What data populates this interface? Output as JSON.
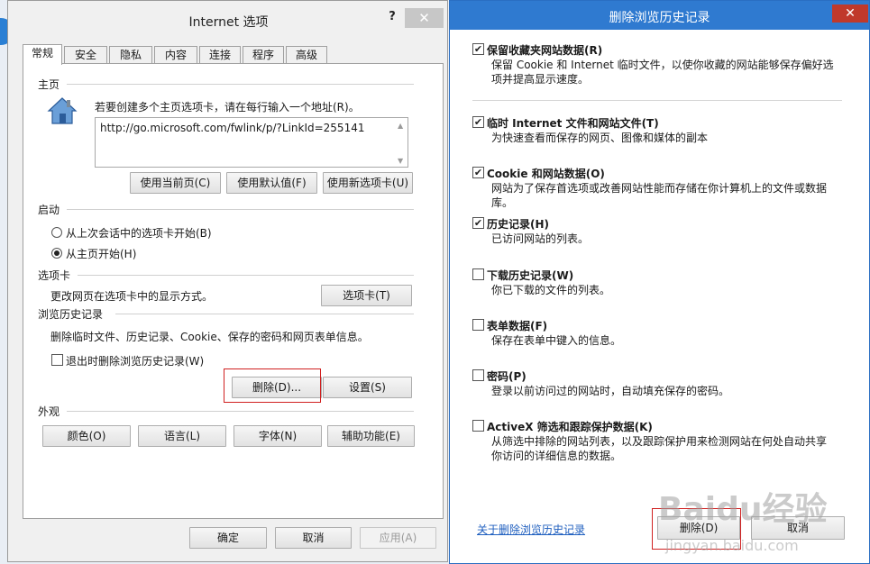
{
  "left_dialog": {
    "title": "Internet 选项",
    "help": "?",
    "close": "✕",
    "tabs": [
      "常规",
      "安全",
      "隐私",
      "内容",
      "连接",
      "程序",
      "高级"
    ],
    "home": {
      "section": "主页",
      "hint": "若要创建多个主页选项卡，请在每行输入一个地址(R)。",
      "url": "http://go.microsoft.com/fwlink/p/?LinkId=255141",
      "buttons": [
        "使用当前页(C)",
        "使用默认值(F)",
        "使用新选项卡(U)"
      ]
    },
    "startup": {
      "section": "启动",
      "option1": "从上次会话中的选项卡开始(B)",
      "option2": "从主页开始(H)"
    },
    "tabs_section": {
      "section": "选项卡",
      "desc": "更改网页在选项卡中的显示方式。",
      "button": "选项卡(T)"
    },
    "history": {
      "section": "浏览历史记录",
      "desc": "删除临时文件、历史记录、Cookie、保存的密码和网页表单信息。",
      "checkbox": "退出时删除浏览历史记录(W)",
      "delete_button": "删除(D)...",
      "settings_button": "设置(S)"
    },
    "appearance": {
      "section": "外观",
      "buttons": [
        "颜色(O)",
        "语言(L)",
        "字体(N)",
        "辅助功能(E)"
      ]
    },
    "footer": {
      "ok": "确定",
      "cancel": "取消",
      "apply": "应用(A)"
    }
  },
  "right_dialog": {
    "title": "删除浏览历史记录",
    "close": "✕",
    "options": [
      {
        "title": "保留收藏夹网站数据(R)",
        "desc": "保留 Cookie 和 Internet 临时文件，以使你收藏的网站能够保存偏好选项并提高显示速度。",
        "checked": true
      },
      {
        "title": "临时 Internet 文件和网站文件(T)",
        "desc": "为快速查看而保存的网页、图像和媒体的副本",
        "checked": true
      },
      {
        "title": "Cookie 和网站数据(O)",
        "desc": "网站为了保存首选项或改善网站性能而存储在你计算机上的文件或数据库。",
        "checked": true
      },
      {
        "title": "历史记录(H)",
        "desc": "已访问网站的列表。",
        "checked": true
      },
      {
        "title": "下载历史记录(W)",
        "desc": "你已下载的文件的列表。",
        "checked": false
      },
      {
        "title": "表单数据(F)",
        "desc": "保存在表单中键入的信息。",
        "checked": false
      },
      {
        "title": "密码(P)",
        "desc": "登录以前访问过的网站时，自动填充保存的密码。",
        "checked": false
      },
      {
        "title": "ActiveX 筛选和跟踪保护数据(K)",
        "desc": "从筛选中排除的网站列表，以及跟踪保护用来检测网站在何处自动共享你访问的详细信息的数据。",
        "checked": false
      }
    ],
    "link": "关于删除浏览历史记录",
    "delete_button": "删除(D)",
    "cancel_button": "取消"
  },
  "watermark": {
    "brand": "Baidu经验",
    "url": "jingyan.baidu.com"
  },
  "check_mark": "✔"
}
